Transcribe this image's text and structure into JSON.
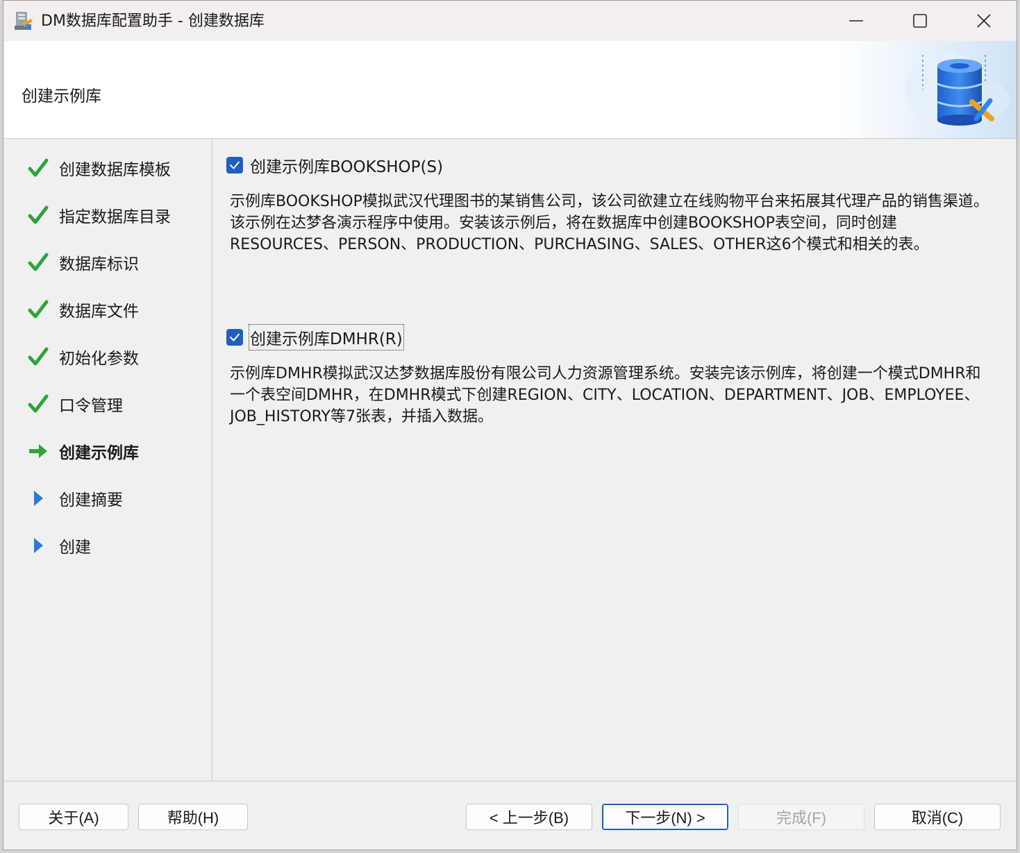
{
  "window": {
    "title": "DM数据库配置助手 - 创建数据库",
    "page_title": "创建示例库"
  },
  "steps": [
    {
      "label": "创建数据库模板",
      "status": "done"
    },
    {
      "label": "指定数据库目录",
      "status": "done"
    },
    {
      "label": "数据库标识",
      "status": "done"
    },
    {
      "label": "数据库文件",
      "status": "done"
    },
    {
      "label": "初始化参数",
      "status": "done"
    },
    {
      "label": "口令管理",
      "status": "done"
    },
    {
      "label": "创建示例库",
      "status": "current"
    },
    {
      "label": "创建摘要",
      "status": "pending"
    },
    {
      "label": "创建",
      "status": "pending"
    }
  ],
  "options": {
    "bookshop": {
      "label": "创建示例库BOOKSHOP(S)",
      "checked": true,
      "description": "示例库BOOKSHOP模拟武汉代理图书的某销售公司，该公司欲建立在线购物平台来拓展其代理产品的销售渠道。该示例在达梦各演示程序中使用。安装该示例后，将在数据库中创建BOOKSHOP表空间，同时创建RESOURCES、PERSON、PRODUCTION、PURCHASING、SALES、OTHER这6个模式和相关的表。"
    },
    "dmhr": {
      "label": "创建示例库DMHR(R)",
      "checked": true,
      "description": "示例库DMHR模拟武汉达梦数据库股份有限公司人力资源管理系统。安装完该示例库，将创建一个模式DMHR和一个表空间DMHR，在DMHR模式下创建REGION、CITY、LOCATION、DEPARTMENT、JOB、EMPLOYEE、JOB_HISTORY等7张表，并插入数据。"
    }
  },
  "buttons": {
    "about": "关于(A)",
    "help": "帮助(H)",
    "prev": "< 上一步(B)",
    "next": "下一步(N) >",
    "finish": "完成(F)",
    "cancel": "取消(C)"
  },
  "colors": {
    "done_check": "#2ea43a",
    "current_arrow": "#2ea43a",
    "pending_triangle": "#2a7bd6",
    "checkbox": "#1f5fbd"
  }
}
